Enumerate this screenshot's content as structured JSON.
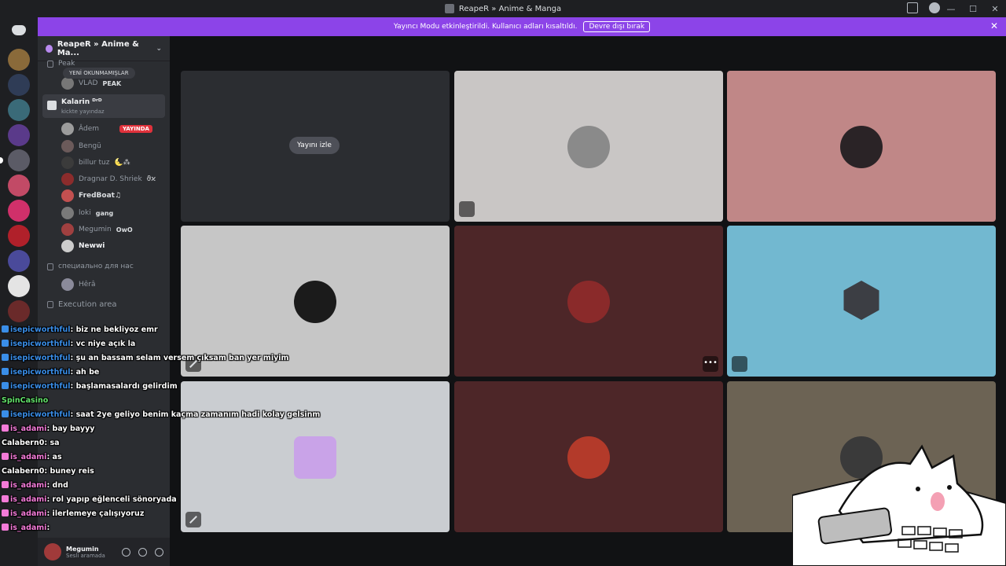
{
  "window": {
    "title": "ReapeR » Anime & Manga"
  },
  "banner": {
    "message": "Yayıncı Modu etkinleştirildi. Kullanıcı adları kısaltıldı.",
    "button": "Devre dışı bırak"
  },
  "guild": {
    "name": "ReapeR » Anime & Ma..."
  },
  "sidebar": {
    "top_category": "Peak",
    "new_unread": "YENİ OKUNMAMIŞLAR",
    "vlad_name": "VLAD",
    "vlad_tag": "PEAK",
    "voice_channel": {
      "name": "Kalarin ᴰʳᴰ",
      "sub": "kickte yayındaz"
    },
    "members": [
      {
        "name": "Âdem",
        "tag": "",
        "live": "YAYINDA",
        "color": "#9c9c9c"
      },
      {
        "name": "Bengü",
        "tag": "",
        "live": "",
        "color": "#6b5a5a"
      },
      {
        "name": "billur tuz",
        "tag": "🌜⁂",
        "live": "",
        "color": "#3b3b3b"
      },
      {
        "name": "Dragnar D. Shriek",
        "tag": "ϑϰ",
        "live": "",
        "color": "#8c2c2c"
      },
      {
        "name": "FredBoat♫",
        "tag": "",
        "live": "",
        "color": "#c25050"
      },
      {
        "name": "loki",
        "tag": "gang",
        "live": "",
        "color": "#7a7a7a"
      },
      {
        "name": "Megumin",
        "tag": "OwO",
        "live": "",
        "color": "#a04040"
      },
      {
        "name": "Newwi",
        "tag": "",
        "live": "",
        "color": "#cccccc"
      }
    ],
    "category_2": "специально для нас",
    "hera": "Hêrâ",
    "category_3": "Execution area",
    "user": {
      "name": "Megumin",
      "status": "Sesli aramada"
    }
  },
  "stage": {
    "watch_label": "Yayını izle",
    "tiles": [
      {
        "bg": "#2b2d31",
        "avatar": "",
        "muted": false
      },
      {
        "bg": "#c9c6c5",
        "avatar": "#8a8a8a",
        "muted": true
      },
      {
        "bg": "#c08787",
        "avatar": "#2a2326",
        "muted": false
      },
      {
        "bg": "#c6c6c6",
        "avatar": "#1b1b1b",
        "muted": true
      },
      {
        "bg": "#4d2628",
        "avatar": "#8a2a2a",
        "muted": false
      },
      {
        "bg": "#72b8d0",
        "avatar": "",
        "muted": false
      },
      {
        "bg": "#cacdd1",
        "avatar": "#c9a3e8",
        "muted": true
      },
      {
        "bg": "#4d2628",
        "avatar": "#b33a2a",
        "muted": false
      },
      {
        "bg": "#6c6354",
        "avatar": "#3a3a3a",
        "muted": false
      }
    ]
  },
  "chat": [
    {
      "user": "isepicworthful",
      "msg": ": biz ne bekliyoz emr",
      "color": "blue"
    },
    {
      "user": "isepicworthful",
      "msg": ": vc niye açık la",
      "color": "blue"
    },
    {
      "user": "isepicworthful",
      "msg": ": şu an bassam selam versem çıksam ban yer miyim",
      "color": "blue"
    },
    {
      "user": "isepicworthful",
      "msg": ": ah be",
      "color": "blue"
    },
    {
      "user": "isepicworthful",
      "msg": ": başlamasalardı gelirdim",
      "color": "blue"
    },
    {
      "user": "SpinCasino",
      "msg": "",
      "color": "green"
    },
    {
      "user": "isepicworthful",
      "msg": ": saat 2ye geliyo benim kaçma zamanım hadi kolay gelsinm",
      "color": "blue"
    },
    {
      "user": "is_adami",
      "msg": ": bay bayyy",
      "color": "pink"
    },
    {
      "user": "Calabern0",
      "msg": ": sa",
      "color": "white"
    },
    {
      "user": "is_adami",
      "msg": ": as",
      "color": "pink"
    },
    {
      "user": "Calabern0",
      "msg": ": buney reis",
      "color": "white"
    },
    {
      "user": "is_adami",
      "msg": ": dnd",
      "color": "pink"
    },
    {
      "user": "is_adami",
      "msg": ": rol yapıp eğlenceli sönoryada",
      "color": "pink"
    },
    {
      "user": "is_adami",
      "msg": ": ilerlemeye çalışıyoruz",
      "color": "pink"
    },
    {
      "user": "is_adami",
      "msg": ":",
      "color": "pink"
    }
  ],
  "colors": {
    "banner": "#8c44e8",
    "live": "#e0323c",
    "chat_blue": "#3a8ee8",
    "chat_pink": "#f37bd8"
  }
}
